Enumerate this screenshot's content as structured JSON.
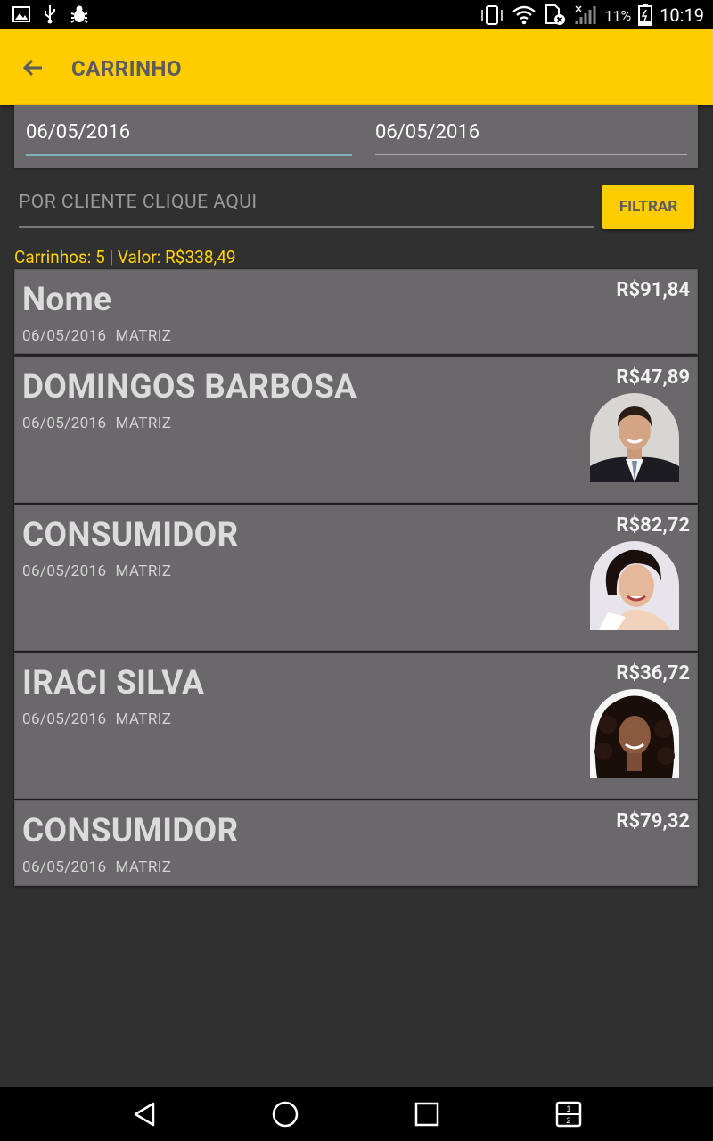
{
  "status_bar": {
    "battery": "11%",
    "time": "10:19",
    "left_icons": [
      "image-icon",
      "usb-icon",
      "bug-icon"
    ],
    "right_icons": [
      "rotation-lock-icon",
      "wifi-icon",
      "sim-error-icon",
      "signal-icon",
      "battery-icon"
    ]
  },
  "app_bar": {
    "title": "CARRINHO",
    "background": "#FFCC00"
  },
  "filters": {
    "date_from": "06/05/2016",
    "date_to": "06/05/2016",
    "client_placeholder": "POR CLIENTE CLIQUE AQUI",
    "filter_button": "FILTRAR"
  },
  "summary": "Carrinhos: 5 | Valor: R$338,49",
  "carts": [
    {
      "name": "Nome",
      "date": "06/05/2016",
      "store": "MATRIZ",
      "value": "R$91,84",
      "avatar": "none"
    },
    {
      "name": "DOMINGOS BARBOSA",
      "date": "06/05/2016",
      "store": "MATRIZ",
      "value": "R$47,89",
      "avatar": "man-in-suit"
    },
    {
      "name": "CONSUMIDOR",
      "date": "06/05/2016",
      "store": "MATRIZ",
      "value": "R$82,72",
      "avatar": "smiling-woman"
    },
    {
      "name": "IRACI SILVA",
      "date": "06/05/2016",
      "store": "MATRIZ",
      "value": "R$36,72",
      "avatar": "curly-hair-woman"
    },
    {
      "name": "CONSUMIDOR",
      "date": "06/05/2016",
      "store": "MATRIZ",
      "value": "R$79,32",
      "avatar": "none"
    }
  ],
  "nav_bar": [
    "back-triangle-icon",
    "home-circle-icon",
    "recents-square-icon",
    "multiwindow-icon"
  ]
}
